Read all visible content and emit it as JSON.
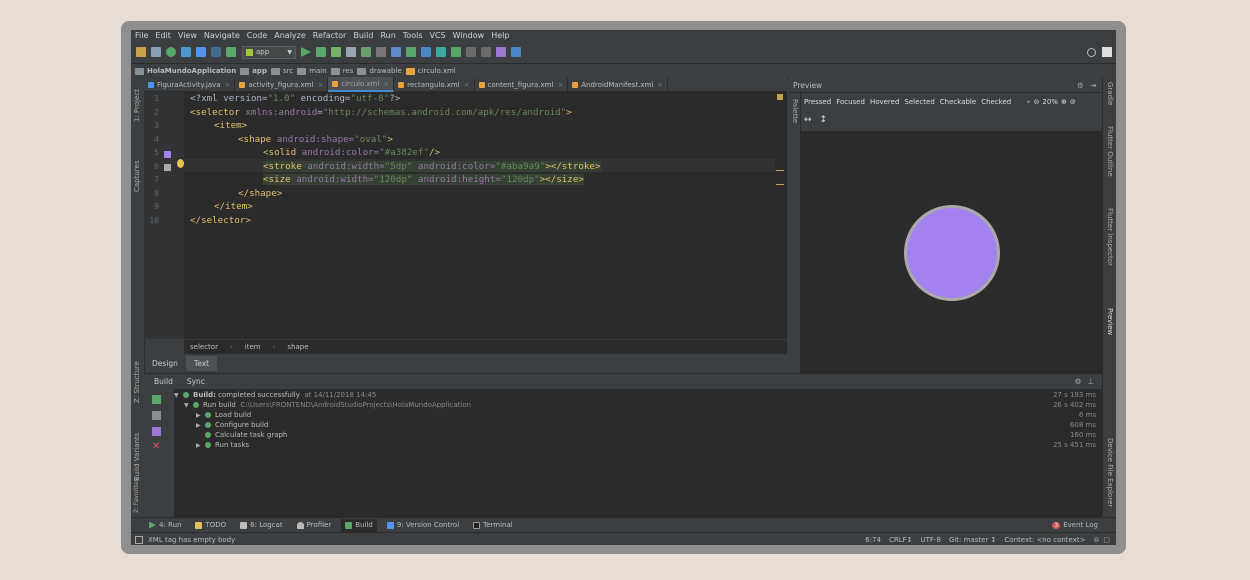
{
  "menu": [
    "File",
    "Edit",
    "View",
    "Navigate",
    "Code",
    "Analyze",
    "Refactor",
    "Build",
    "Run",
    "Tools",
    "VCS",
    "Window",
    "Help"
  ],
  "toolbar": {
    "config": "app"
  },
  "breadcrumbs": [
    "HolaMundoApplication",
    "app",
    "src",
    "main",
    "res",
    "drawable",
    "circulo.xml"
  ],
  "left_stripe": {
    "project": "1: Project",
    "captures": "Captures",
    "structure": "Z: Structure",
    "build_variants": "Build Variants",
    "favorites": "2: Favorites"
  },
  "right_stripe": {
    "gradle": "Gradle",
    "flutter_outline": "Flutter Outline",
    "flutter_inspector": "Flutter Inspector",
    "preview": "Preview",
    "device_explorer": "Device File Explorer"
  },
  "editor_tabs": [
    {
      "label": "FiguraActivity.java",
      "color": "#5394ec"
    },
    {
      "label": "activity_figura.xml",
      "color": "#e8a33e"
    },
    {
      "label": "circulo.xml",
      "color": "#e8a33e",
      "active": true
    },
    {
      "label": "rectangulo.xml",
      "color": "#e8a33e"
    },
    {
      "label": "content_figura.xml",
      "color": "#e8a33e"
    },
    {
      "label": "AndroidManifest.xml",
      "color": "#e8a33e"
    }
  ],
  "line_numbers": [
    "1",
    "2",
    "3",
    "4",
    "5",
    "6",
    "7",
    "8",
    "9",
    "10"
  ],
  "code": {
    "l1": {
      "a": "<?xml version=",
      "b": "\"1.0\"",
      "c": " encoding=",
      "d": "\"utf-8\"",
      "e": "?>"
    },
    "l2": {
      "a": "<selector ",
      "b": "xmlns:",
      "c": "android",
      "d": "=",
      "e": "\"http://schemas.android.com/apk/res/android\"",
      "f": ">"
    },
    "l3": "<item>",
    "l4": {
      "a": "<shape ",
      "b": "android:shape=",
      "c": "\"oval\"",
      "d": ">"
    },
    "l5": {
      "a": "<solid ",
      "b": "android:color=",
      "c": "\"#a382ef\"",
      "d": "/>"
    },
    "l6": {
      "a": "<stroke ",
      "b": "android:width=",
      "c": "\"5dp\"",
      "d": " android:color=",
      "e": "\"#aba9a9\"",
      "f": "></stroke>"
    },
    "l7": {
      "a": "<size ",
      "b": "android:width=",
      "c": "\"120dp\"",
      "d": " android:height=",
      "e": "\"120dp\"",
      "f": "></size>"
    },
    "l8": "</shape>",
    "l9": "</item>",
    "l10": "</selector>"
  },
  "editor_crumbs": [
    "selector",
    "item",
    "shape"
  ],
  "design_tabs": [
    "Design",
    "Text"
  ],
  "preview": {
    "title": "Preview",
    "palette": "Palette",
    "states": [
      "Pressed",
      "Focused",
      "Hovered",
      "Selected",
      "Checkable",
      "Checked"
    ],
    "zoom": "20%",
    "shape_fill": "#a382ef",
    "shape_stroke": "#aba9a9"
  },
  "build": {
    "tabs": [
      "Build",
      "Sync"
    ],
    "rows": [
      {
        "label": "Build:",
        "extra": "completed successfully",
        "path": "at 14/11/2018 14:45",
        "time": "27 s 193 ms"
      },
      {
        "label": "Run build",
        "path": "C:\\Users\\FRONTEND\\AndroidStudioProjects\\HolaMundoApplication",
        "time": "26 s 402 ms"
      },
      {
        "label": "Load build",
        "time": "6 ms"
      },
      {
        "label": "Configure build",
        "time": "608 ms"
      },
      {
        "label": "Calculate task graph",
        "time": "160 ms"
      },
      {
        "label": "Run tasks",
        "time": "25 s 451 ms"
      }
    ]
  },
  "bottom_tabs": [
    {
      "label": "4: Run",
      "color": "#59a869"
    },
    {
      "label": "TODO",
      "color": "#e0c05a"
    },
    {
      "label": "6: Logcat",
      "color": "#bbbbbb"
    },
    {
      "label": "Profiler",
      "color": "#bbbbbb"
    },
    {
      "label": "Build",
      "color": "#59a869",
      "active": true
    },
    {
      "label": "9: Version Control",
      "color": "#5394ec"
    },
    {
      "label": "Terminal",
      "color": "#bbbbbb"
    }
  ],
  "event_log": "Event Log",
  "event_count": "3",
  "status": {
    "message": "XML tag has empty body",
    "position": "6:74",
    "line_sep": "CRLF↕",
    "encoding": "UTF-8",
    "git": "Git: master ↕",
    "context": "Context: <no context>"
  }
}
